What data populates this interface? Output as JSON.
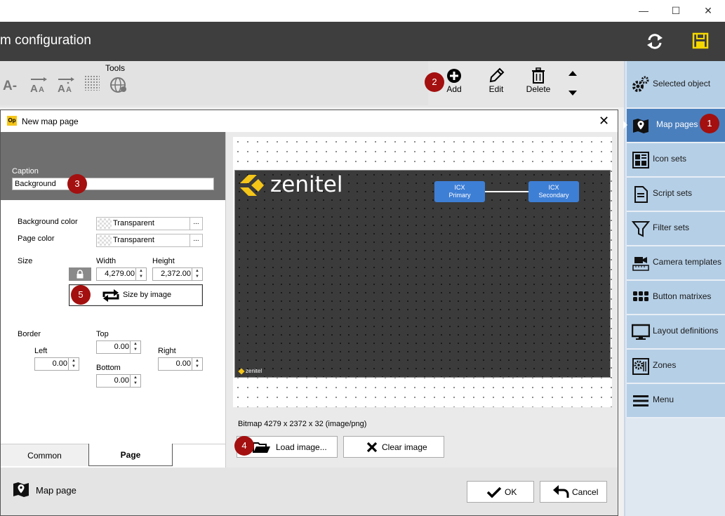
{
  "window": {
    "minimize_glyph": "—",
    "maximize_glyph": "☐",
    "close_glyph": "✕"
  },
  "header": {
    "title": "m configuration",
    "refresh_icon": "refresh-icon",
    "save_icon": "save-icon",
    "save_color": "#f5d800"
  },
  "toolbar": {
    "tools_group_label": "Tools",
    "font_smaller_glyph": "A-",
    "add_label": "Add",
    "edit_label": "Edit",
    "delete_label": "Delete"
  },
  "sidebar": {
    "items": [
      {
        "label": "Selected object",
        "icon": "gears-icon"
      },
      {
        "label": "Map pages",
        "icon": "map-pin-icon",
        "active": true
      },
      {
        "label": "Icon sets",
        "icon": "icon-grid-icon"
      },
      {
        "label": "Script sets",
        "icon": "document-icon"
      },
      {
        "label": "Filter sets",
        "icon": "funnel-icon"
      },
      {
        "label": "Camera templates",
        "icon": "camera-icon"
      },
      {
        "label": "Button matrixes",
        "icon": "button-grid-icon"
      },
      {
        "label": "Layout definitions",
        "icon": "monitor-icon"
      },
      {
        "label": "Zones",
        "icon": "zones-icon"
      },
      {
        "label": "Menu",
        "icon": "hamburger-icon"
      }
    ],
    "accent": "#4a7fbd",
    "item_color": "#b5cfe6"
  },
  "dialog": {
    "app_badge": "Op",
    "title": "New map page",
    "close_glyph": "✕",
    "caption_label": "Caption",
    "caption_value": "Background",
    "background_color_label": "Background color",
    "background_color_value": "Transparent",
    "page_color_label": "Page color",
    "page_color_value": "Transparent",
    "color_picker_glyph": "...",
    "size_label": "Size",
    "width_label": "Width",
    "width_value": "4,279.00",
    "height_label": "Height",
    "height_value": "2,372.00",
    "size_by_image_label": "Size by image",
    "border_label": "Border",
    "top_label": "Top",
    "top_value": "0.00",
    "left_label": "Left",
    "left_value": "0.00",
    "right_label": "Right",
    "right_value": "0.00",
    "bottom_label": "Bottom",
    "bottom_value": "0.00",
    "tabs": [
      {
        "label": "Common",
        "active": false
      },
      {
        "label": "Page",
        "active": true
      }
    ],
    "preview": {
      "logo_text": "zenitel",
      "small_logo_text": "zenitel",
      "icx_primary_line1": "ICX",
      "icx_primary_line2": "Primary",
      "icx_secondary_line1": "ICX",
      "icx_secondary_line2": "Secondary"
    },
    "bitmap_info": "Bitmap 4279 x 2372 x 32 (image/png)",
    "load_image_label": "Load image...",
    "clear_image_label": "Clear image",
    "footer_label": "Map page",
    "ok_label": "OK",
    "cancel_label": "Cancel"
  },
  "markers": [
    "1",
    "2",
    "3",
    "4",
    "5"
  ]
}
